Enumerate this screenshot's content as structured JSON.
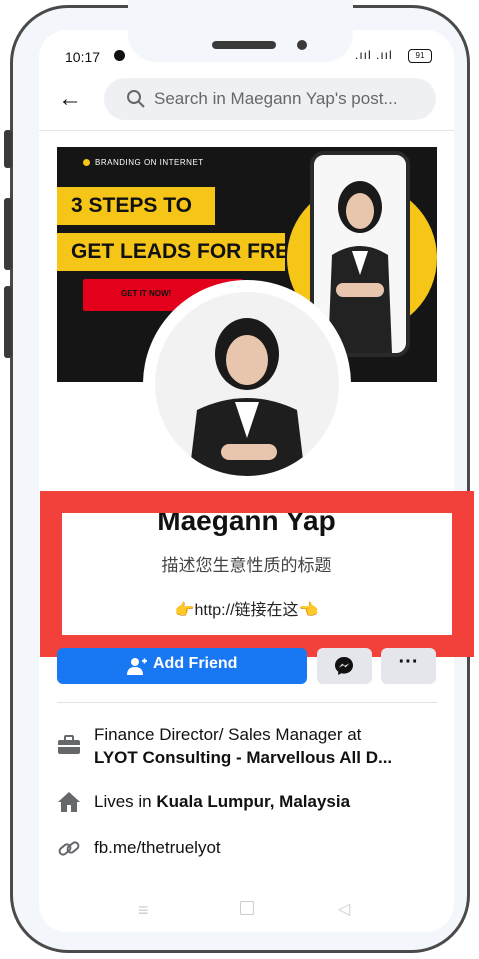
{
  "status_bar": {
    "time": "10:17",
    "signal": ".ııl .ııl",
    "battery": "91"
  },
  "search": {
    "placeholder": "Search in Maegann Yap's post..."
  },
  "banner": {
    "brand_text": "BRANDING ON INTERNET",
    "line1": "3 STEPS TO",
    "line2": "GET LEADS FOR FREE!",
    "cta": "GET IT NOW!"
  },
  "profile": {
    "name": "Maegann Yap",
    "tagline": "描述您生意性质的标题",
    "link": "👉http://链接在这👈"
  },
  "actions": {
    "add_friend": "Add Friend",
    "more": "···"
  },
  "intro": {
    "work_line1": "Finance Director/ Sales Manager at",
    "work_line2": "LYOT Consulting - Marvellous All D...",
    "lives_prefix": "Lives in ",
    "lives_city": "Kuala Lumpur, Malaysia",
    "website": "fb.me/thetruelyot"
  },
  "colors": {
    "accent": "#1877f2",
    "highlight": "#f2403a",
    "banner_yellow": "#f5c518",
    "banner_red": "#e3001b"
  }
}
